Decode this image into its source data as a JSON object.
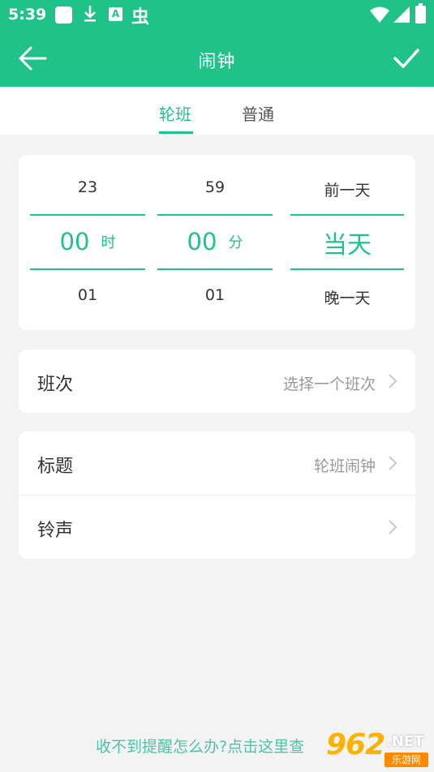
{
  "status_bar": {
    "time": "5:39",
    "notification_icons": [
      "app-square-icon",
      "download-icon",
      "translate-icon",
      "bug-icon"
    ],
    "bug_glyph": "虫",
    "translate_glyph": "A",
    "system_icons": [
      "wifi-icon",
      "signal-icon",
      "battery-icon"
    ]
  },
  "header": {
    "title": "闹钟",
    "back_icon": "arrow-left-icon",
    "confirm_icon": "check-icon",
    "color": "#1fc289"
  },
  "tabs": [
    {
      "label": "轮班",
      "active": true
    },
    {
      "label": "普通",
      "active": false
    }
  ],
  "picker": {
    "hour": {
      "above": "23",
      "selected": "00",
      "unit": "时",
      "below": "01"
    },
    "minute": {
      "above": "59",
      "selected": "00",
      "unit": "分",
      "below": "01"
    },
    "day": {
      "above": "前一天",
      "selected": "当天",
      "below": "晚一天"
    }
  },
  "settings": {
    "shift": {
      "label": "班次",
      "value": "选择一个班次"
    },
    "title": {
      "label": "标题",
      "value": "轮班闹钟"
    },
    "ringtone": {
      "label": "铃声",
      "value": ""
    }
  },
  "help_text": "收不到提醒怎么办?点击这里查",
  "watermark": {
    "number": "962",
    "suffix": ".NET",
    "site": "乐游网"
  }
}
